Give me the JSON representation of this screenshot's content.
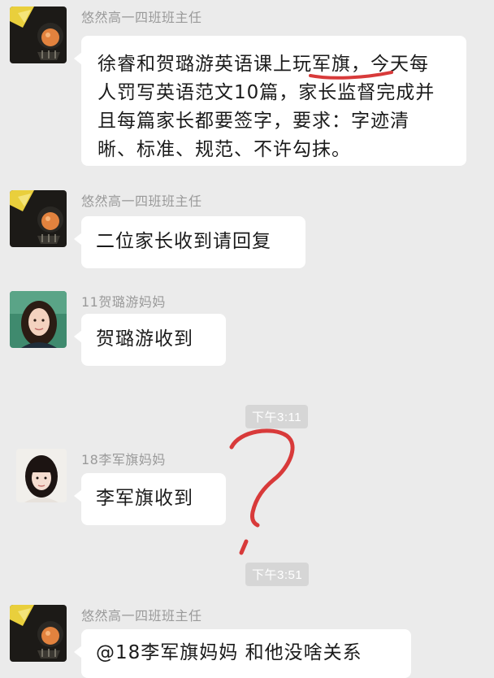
{
  "messages": [
    {
      "sender": "悠然高一四班班主任",
      "text": "徐睿和贺璐游英语课上玩军旗，今天每人罚写英语范文10篇，家长监督完成并且每篇家长都要签字，要求：字迹清晰、标准、规范、不许勾抹。"
    },
    {
      "sender": "悠然高一四班班主任",
      "text": "二位家长收到请回复"
    },
    {
      "sender": "11贺璐游妈妈",
      "text": "贺璐游收到"
    },
    {
      "sender": "18李军旗妈妈",
      "text": "李军旗收到"
    },
    {
      "sender": "悠然高一四班班主任",
      "text": "@18李军旗妈妈 和他没啥关系"
    }
  ],
  "timestamps": [
    "下午3:11",
    "下午3:51"
  ],
  "colors": {
    "background": "#ebebeb",
    "bubble": "#ffffff",
    "annotation_red": "#d83a3a"
  },
  "annotations": {
    "question_mark": "red-hand-drawn-question-mark",
    "underline": "red-hand-drawn-underline"
  }
}
